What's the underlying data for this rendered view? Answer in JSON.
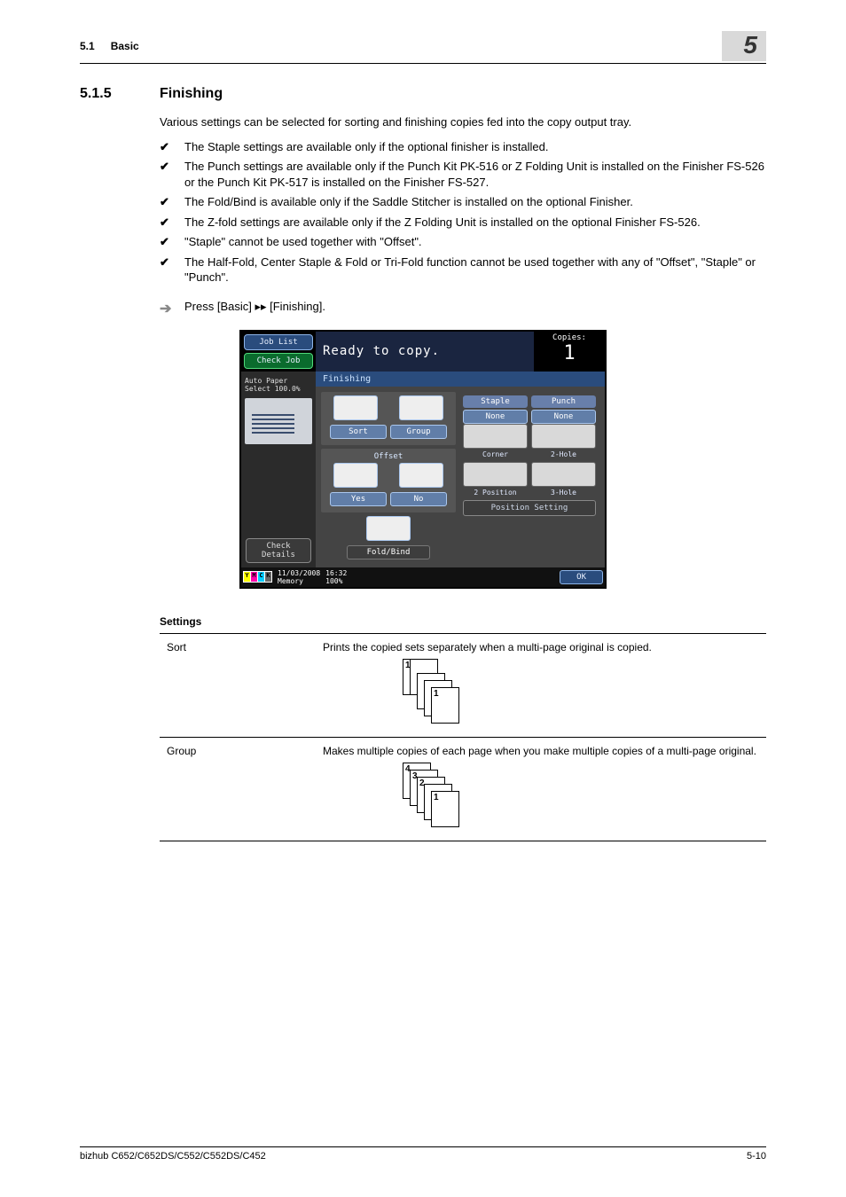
{
  "header": {
    "section_num": "5.1",
    "section_name": "Basic",
    "chapter": "5"
  },
  "heading": {
    "num": "5.1.5",
    "title": "Finishing"
  },
  "intro": "Various settings can be selected for sorting and finishing copies fed into the copy output tray.",
  "bullets": [
    "The Staple settings are available only if the optional finisher is installed.",
    "The Punch settings are available only if the Punch Kit PK-516 or Z Folding Unit is installed on the Finisher FS-526 or the Punch Kit PK-517 is installed on the Finisher FS-527.",
    "The Fold/Bind is available only if the Saddle Stitcher is installed on the optional Finisher.",
    "The Z-fold settings are available only if the Z Folding Unit is installed on the optional Finisher FS-526.",
    "\"Staple\" cannot be used together with \"Offset\".",
    "The Half-Fold, Center Staple & Fold or Tri-Fold function cannot be used together with any of \"Offset\", \"Staple\" or \"Punch\"."
  ],
  "step": "Press [Basic] ▸▸ [Finishing].",
  "panel": {
    "job_list": "Job List",
    "check_job": "Check Job",
    "status": "Ready to copy.",
    "copies_label": "Copies:",
    "copies_num": "1",
    "tab": "Finishing",
    "auto_paper": "Auto Paper Select  100.0%",
    "check_details": "Check Details",
    "sort": "Sort",
    "group": "Group",
    "offset": "Offset",
    "yes": "Yes",
    "no": "No",
    "fold_bind": "Fold/Bind",
    "staple": "Staple",
    "punch": "Punch",
    "none": "None",
    "corner": "Corner",
    "two_hole": "2-Hole",
    "two_pos": "2 Position",
    "three_hole": "3-Hole",
    "position_setting": "Position Setting",
    "date": "11/03/2008",
    "time": "16:32",
    "memory": "Memory",
    "mem_pct": "100%",
    "ok": "OK"
  },
  "settings": {
    "title": "Settings",
    "rows": [
      {
        "name": "Sort",
        "desc": "Prints the copied sets separately when a multi-page original is copied."
      },
      {
        "name": "Group",
        "desc": "Makes multiple copies of each page when you make multiple copies of a multi-page original."
      }
    ]
  },
  "footer": {
    "model": "bizhub C652/C652DS/C552/C552DS/C452",
    "page": "5-10"
  }
}
